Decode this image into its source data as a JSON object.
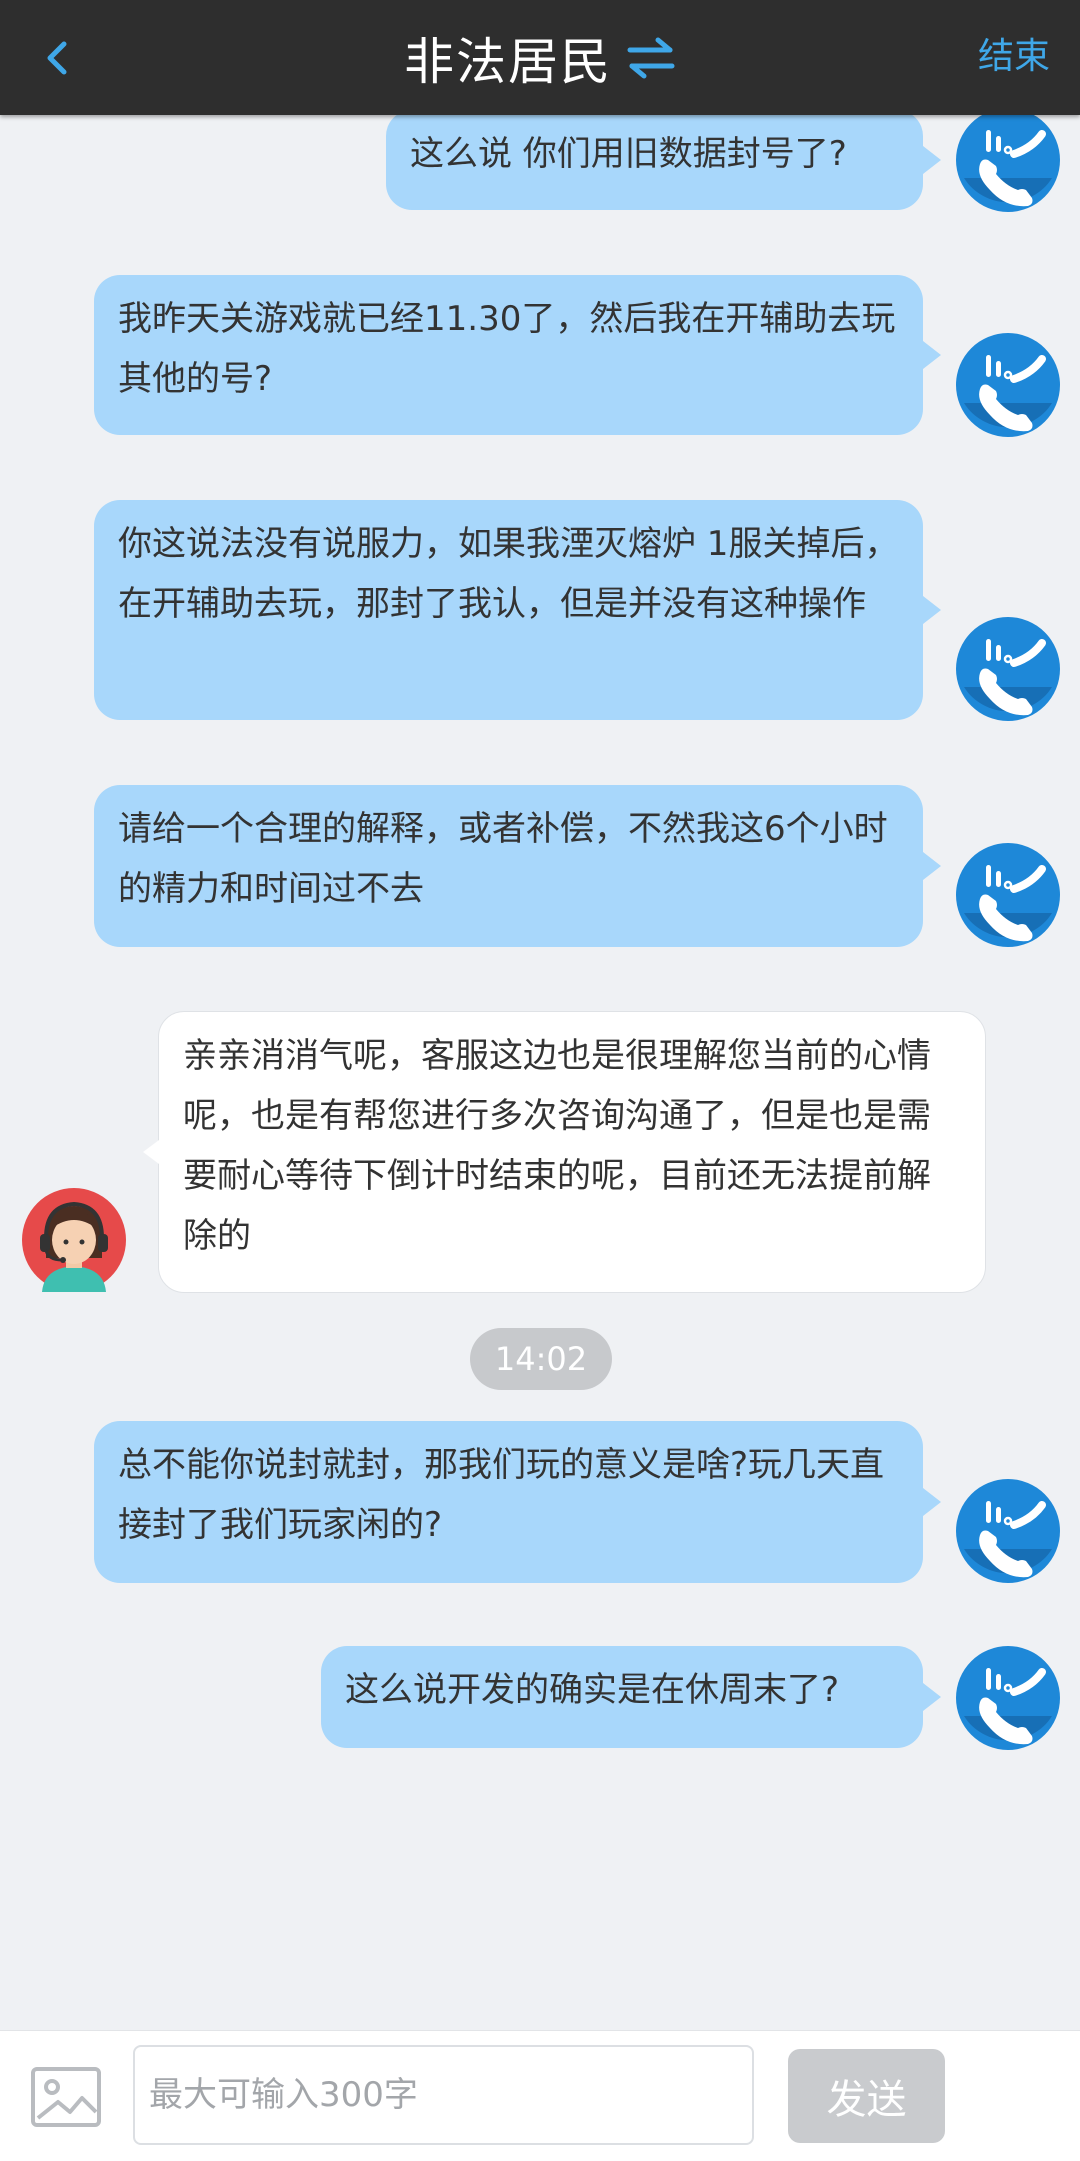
{
  "header": {
    "title": "非法居民",
    "end_label": "结束"
  },
  "colors": {
    "header_bg": "#2e2e2e",
    "accent": "#3fa7e8",
    "user_bubble": "#a8d7fb",
    "agent_bubble": "#ffffff",
    "page_bg": "#eff1f4"
  },
  "messages": [
    {
      "sender": "user",
      "text": "这么说 你们用旧数据封号了?"
    },
    {
      "sender": "user",
      "text": "我昨天关游戏就已经11.30了，然后我在开辅助去玩其他的号?"
    },
    {
      "sender": "user",
      "text": "你这说法没有说服力，如果我湮灭熔炉 1服关掉后，在开辅助去玩，那封了我认，但是并没有这种操作"
    },
    {
      "sender": "user",
      "text": "请给一个合理的解释，或者补偿，不然我这6个小时的精力和时间过不去"
    },
    {
      "sender": "agent",
      "text": "亲亲消消气呢，客服这边也是很理解您当前的心情呢，也是有帮您进行多次咨询沟通了，但是也是需要耐心等待下倒计时结束的呢，目前还无法提前解除的"
    },
    {
      "sender": "user",
      "text": "总不能你说封就封，那我们玩的意义是啥?玩几天直接封了我们玩家闲的?"
    },
    {
      "sender": "user",
      "text": "这么说开发的确实是在休周末了?"
    }
  ],
  "timestamp": "14:02",
  "composer": {
    "placeholder": "最大可输入300字",
    "send_label": "发送"
  },
  "icons": {
    "back": "chevron-left-icon",
    "swap": "swap-arrows-icon",
    "user_avatar": "phone-app-icon",
    "agent_avatar": "customer-service-avatar",
    "image": "image-icon"
  }
}
